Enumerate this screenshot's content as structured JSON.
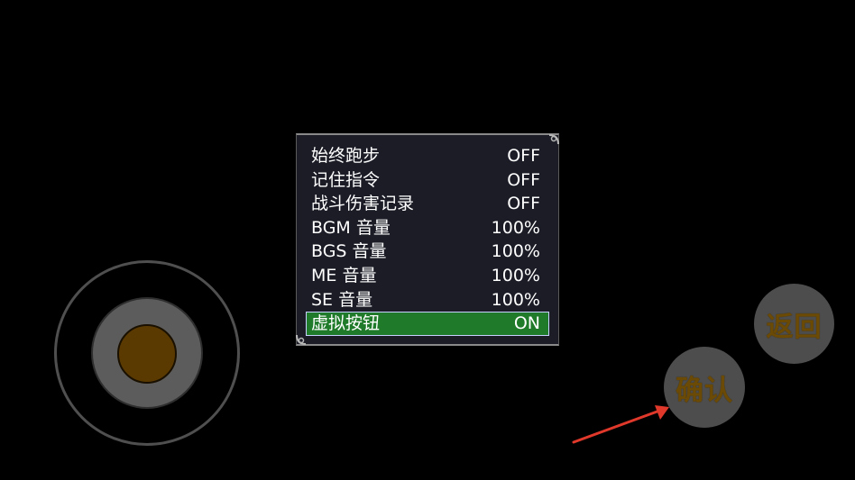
{
  "options": [
    {
      "label": "始终跑步",
      "value": "OFF"
    },
    {
      "label": "记住指令",
      "value": "OFF"
    },
    {
      "label": "战斗伤害记录",
      "value": "OFF"
    },
    {
      "label": "BGM 音量",
      "value": "100%"
    },
    {
      "label": "BGS 音量",
      "value": "100%"
    },
    {
      "label": "ME 音量",
      "value": "100%"
    },
    {
      "label": "SE 音量",
      "value": "100%"
    },
    {
      "label": "虚拟按钮",
      "value": "ON",
      "selected": true
    }
  ],
  "controls": {
    "back_label": "返回",
    "confirm_label": "确认"
  },
  "colors": {
    "window_bg": "#1b1c26",
    "selected_row": "#1f7a2a",
    "button_bg": "#4d4d4d",
    "button_text": "#6b4a06",
    "joystick_knob": "#5a3a00",
    "arrow": "#e0392b"
  },
  "icons": {
    "corner_ornament": "corner-ornament-icon",
    "arrow": "red-arrow-icon"
  }
}
